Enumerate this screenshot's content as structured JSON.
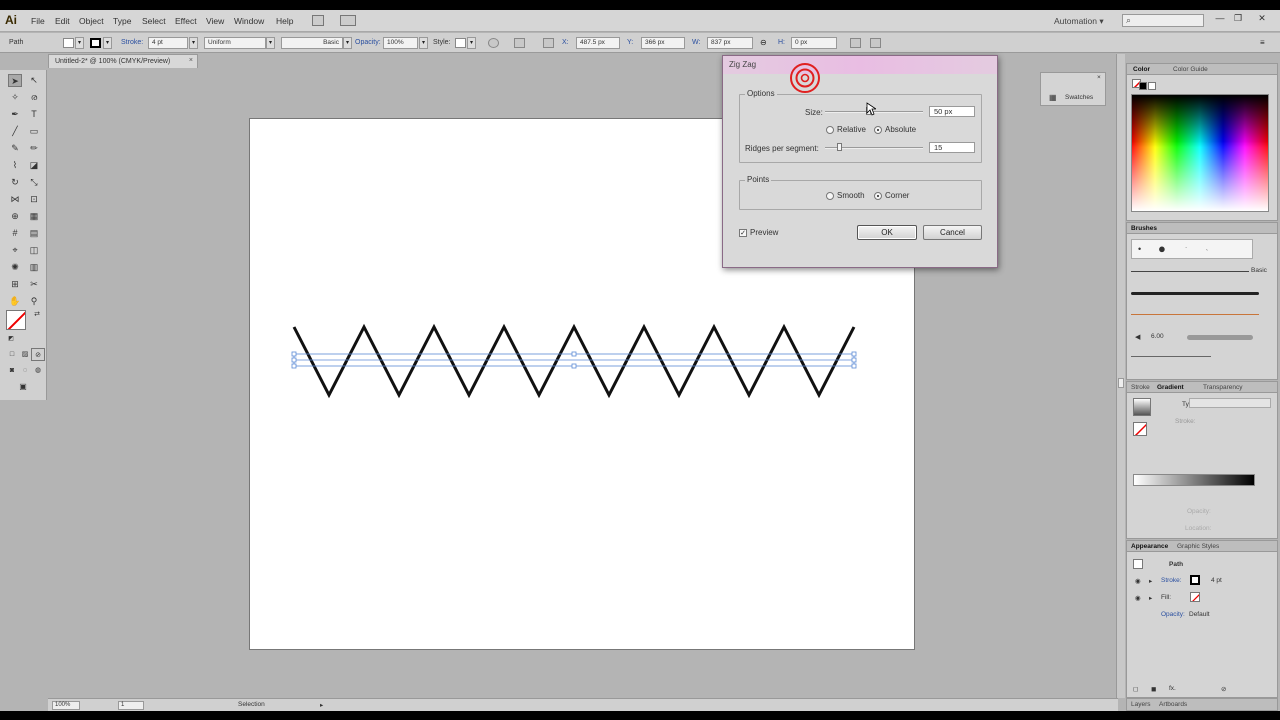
{
  "app": {
    "logo": "Ai",
    "menu": [
      "File",
      "Edit",
      "Object",
      "Type",
      "Select",
      "Effect",
      "View",
      "Window",
      "Help"
    ],
    "workspace": "Automation",
    "workspace_arrow": "▾",
    "window_controls": [
      "—",
      "❐",
      "✕"
    ]
  },
  "control_bar": {
    "selection_type": "Path",
    "stroke_label": "Stroke:",
    "stroke_weight": "4 pt",
    "profile": "Uniform",
    "brush": "Basic",
    "opacity_label": "Opacity:",
    "opacity": "100%",
    "style_label": "Style:",
    "x_label": "X:",
    "x_value": "487.5 px",
    "y_label": "Y:",
    "y_value": "366 px",
    "w_label": "W:",
    "w_value": "837 px",
    "h_label": "H:",
    "h_value": "0 px"
  },
  "document": {
    "tab_title": "Untitled-2* @ 100% (CMYK/Preview)",
    "close": "×"
  },
  "status_bar": {
    "zoom": "100%",
    "artboard": "1",
    "tool": "Selection"
  },
  "panels": {
    "color": {
      "tabs": [
        "Color",
        "Color Guide"
      ]
    },
    "brushes": {
      "title": "Brushes",
      "basic_label": "Basic",
      "size_label": "6.00"
    },
    "swatches": {
      "label": "Swatches"
    },
    "stroke_gradient": {
      "tabs": [
        "Stroke",
        "Gradient",
        "Transparency"
      ],
      "type_label": "Type:",
      "stroke_label": "Stroke:",
      "opacity_label": "Opacity:",
      "location_label": "Location:"
    },
    "appearance": {
      "tabs": [
        "Appearance",
        "Graphic Styles"
      ],
      "header": "Path",
      "rows": [
        {
          "label": "Stroke:",
          "value": "4 pt"
        },
        {
          "label": "Fill:",
          "value": ""
        },
        {
          "label": "Opacity:",
          "value": "Default"
        }
      ],
      "fx_label": "fx."
    },
    "bottom_tabs": [
      "Layers",
      "Artboards"
    ]
  },
  "dialog": {
    "title": "Zig Zag",
    "close": "✕",
    "options_label": "Options",
    "size_label": "Size:",
    "size_value": "50 px",
    "size_fraction": 0.44,
    "relative_label": "Relative",
    "absolute_label": "Absolute",
    "size_mode": "Absolute",
    "ridges_label": "Ridges per segment:",
    "ridges_value": "15",
    "ridges_fraction": 0.15,
    "points_label": "Points",
    "smooth_label": "Smooth",
    "corner_label": "Corner",
    "points_mode": "Corner",
    "preview_label": "Preview",
    "preview_checked": true,
    "ok_label": "OK",
    "cancel_label": "Cancel"
  },
  "colors": {
    "dialog_title_accent": "#e9bde3",
    "link_blue": "#2a4fa0",
    "selection_blue": "#5b8ad6",
    "cursor_ring": "#e02020"
  }
}
